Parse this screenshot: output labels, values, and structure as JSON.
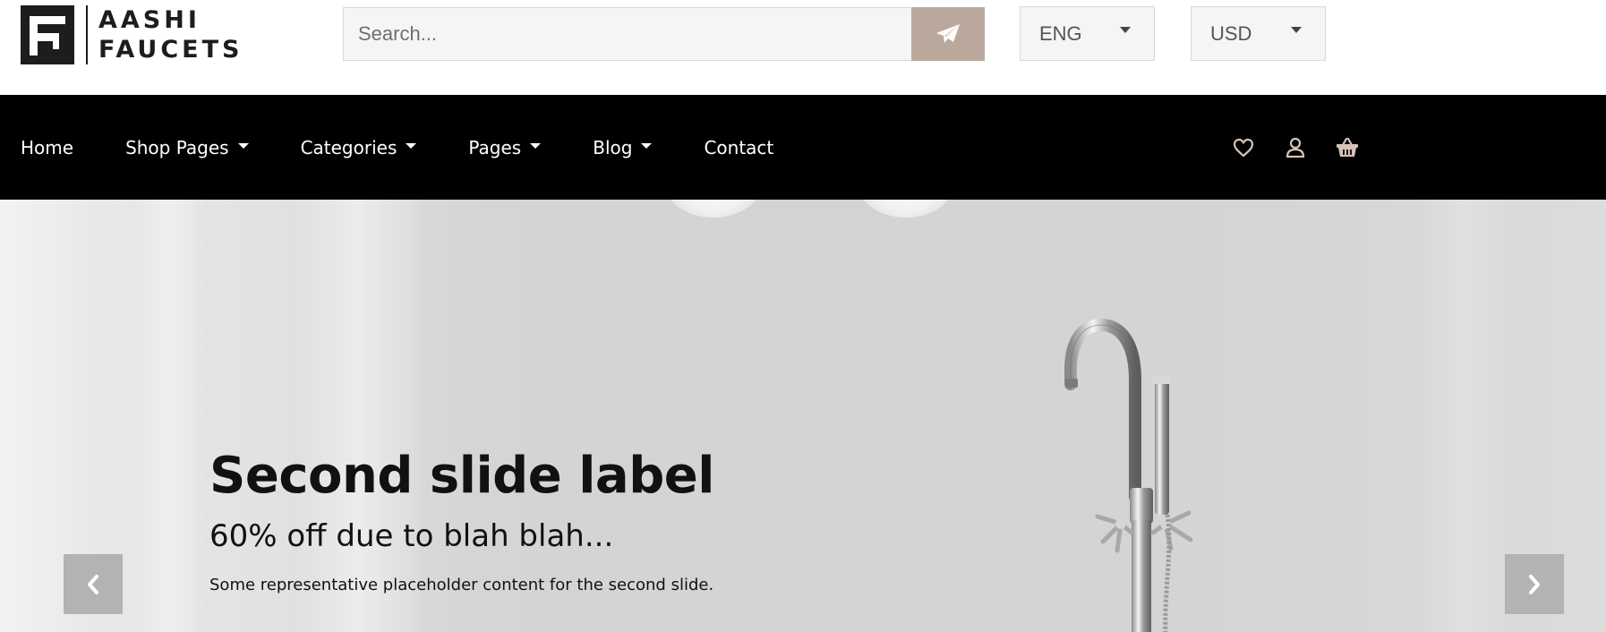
{
  "brand": {
    "name_line1": "AASHI",
    "name_line2": "FAUCETS",
    "logo_icon": "faucet-logo-icon"
  },
  "search": {
    "placeholder": "Search...",
    "value": "",
    "button_icon": "paper-plane-icon"
  },
  "language_select": {
    "selected": "ENG"
  },
  "currency_select": {
    "selected": "USD"
  },
  "nav": {
    "items": [
      {
        "label": "Home",
        "dropdown": false
      },
      {
        "label": "Shop Pages",
        "dropdown": true
      },
      {
        "label": "Categories",
        "dropdown": true
      },
      {
        "label": "Pages",
        "dropdown": true
      },
      {
        "label": "Blog",
        "dropdown": true
      },
      {
        "label": "Contact",
        "dropdown": false
      }
    ],
    "icons": [
      "heart-icon",
      "user-icon",
      "basket-icon"
    ],
    "icon_color": "#d6c2b6"
  },
  "hero": {
    "title": "Second slide label",
    "subtitle": "60% off due to blah blah...",
    "text": "Some representative placeholder content for the second slide.",
    "prev_icon": "chevron-left-icon",
    "next_icon": "chevron-right-icon"
  },
  "colors": {
    "accent": "#bba89d",
    "navbar_bg": "#000000",
    "carousel_control_bg": "#b3b3b3"
  }
}
